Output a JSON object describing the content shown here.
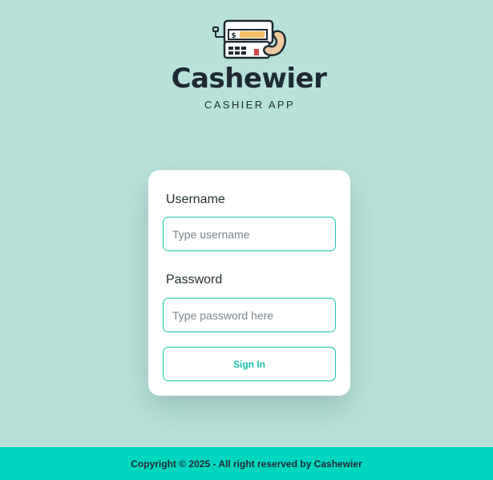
{
  "brand": {
    "name": "Cashewier",
    "tagline": "CASHIER APP",
    "logo_icon": "cash-register-cashew-icon",
    "colors": {
      "register_outline": "#1e2a33",
      "screen": "#f4c06a",
      "cashew": "#f0c9a0",
      "accent_red": "#d8434a"
    }
  },
  "login": {
    "username_label": "Username",
    "username_placeholder": "Type username",
    "password_label": "Password",
    "password_placeholder": "Type password here",
    "submit_label": "Sign In"
  },
  "footer": {
    "text": "Copyright © 2025 - All right reserved by Cashewier"
  },
  "colors": {
    "background": "#b9e1da",
    "accent": "#18c7b1",
    "footer": "#00d6bf",
    "text": "#1e2a33"
  }
}
